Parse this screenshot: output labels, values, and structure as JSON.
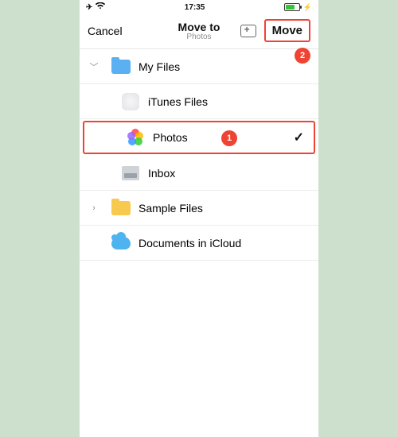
{
  "status": {
    "time": "17:35"
  },
  "nav": {
    "cancel": "Cancel",
    "title": "Move to",
    "subtitle": "Photos",
    "move": "Move"
  },
  "rows": {
    "myfiles": "My Files",
    "itunes": "iTunes Files",
    "photos": "Photos",
    "inbox": "Inbox",
    "sample": "Sample Files",
    "icloud": "Documents in iCloud"
  },
  "annotations": {
    "step1": "1",
    "step2": "2"
  }
}
